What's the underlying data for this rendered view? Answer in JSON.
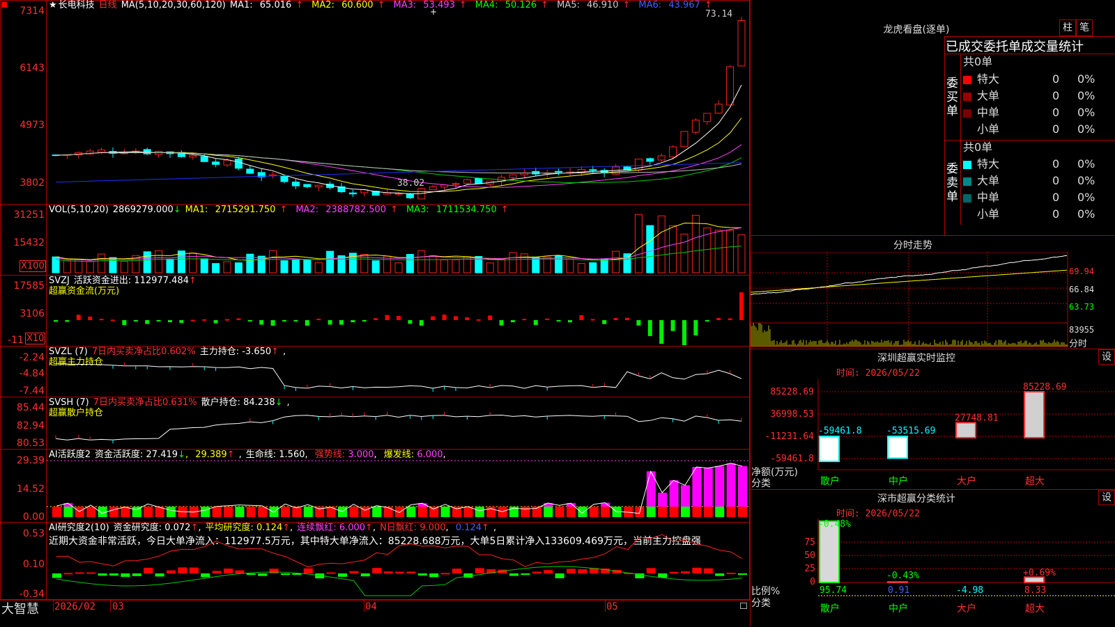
{
  "stock": {
    "name": "长电科技",
    "period": "日线",
    "star": "★"
  },
  "main": {
    "ma_label": "MA(5,10,20,30,60,120)",
    "ma": [
      {
        "label": "MA1:",
        "value": "65.016",
        "arrow": "↑",
        "color": "#ffffff"
      },
      {
        "label": "MA2:",
        "value": "60.600",
        "arrow": "↑",
        "color": "#ffff00"
      },
      {
        "label": "MA3:",
        "value": "53.493",
        "arrow": "↑",
        "color": "#ff40ff"
      },
      {
        "label": "MA4:",
        "value": "50.126",
        "arrow": "↑",
        "color": "#00ff00"
      },
      {
        "label": "MA5:",
        "value": "46.910",
        "arrow": "↑",
        "color": "#cccccc"
      },
      {
        "label": "MA6:",
        "value": "43.967",
        "arrow": "↑",
        "color": "#4060ff"
      }
    ],
    "y_ticks": [
      "7314",
      "6143",
      "4973",
      "3802"
    ],
    "high_label": "73.14",
    "low_label": "38.02"
  },
  "vol": {
    "label": "VOL(5,10,20)",
    "value": "2869279.000",
    "arrow": "↓",
    "ma": [
      {
        "label": "MA1:",
        "value": "2715291.750",
        "arrow": "↑",
        "color": "#ffff00"
      },
      {
        "label": "MA2:",
        "value": "2388782.500",
        "arrow": "↑",
        "color": "#ff40ff"
      },
      {
        "label": "MA3:",
        "value": "1711534.750",
        "arrow": "↑",
        "color": "#00ff00"
      }
    ],
    "y_ticks": [
      "31251",
      "15432"
    ],
    "unit": "X100"
  },
  "svzj": {
    "label": "SVZJ",
    "text": "活跃资金进出:",
    "value": "112977.484",
    "arrow": "↑",
    "sub": "超赢资金流(万元)",
    "y_ticks": [
      "17585",
      "3106",
      "-11"
    ],
    "unit": "X10"
  },
  "svzl": {
    "label": "SVZL (7)",
    "text1": "7日内买卖净占比0.602%",
    "text2": "主力持仓:",
    "value": "-3.650",
    "arrow": "↑",
    "sub": "超赢主力持仓",
    "y_ticks": [
      "-2.24",
      "-4.84",
      "-7.44"
    ]
  },
  "svsh": {
    "label": "SVSH (7)",
    "text1": "7日内买卖净占比0.631%",
    "text2": "散户持仓:",
    "value": "84.238",
    "arrow": "↓",
    "sub": "超赢散户持仓",
    "y_ticks": [
      "85.44",
      "82.94",
      "80.53"
    ]
  },
  "ai_act": {
    "label": "AI活跃度2",
    "text": "资金活跃度:",
    "v1": "27.419",
    "a1": "↓",
    "v2": "29.389",
    "life": "生命线:",
    "life_v": "1.560",
    "strong": "强势线:",
    "strong_v": "3.000",
    "burst": "爆发线:",
    "burst_v": "6.000",
    "y_ticks": [
      "29.39",
      "14.52",
      "0.00"
    ]
  },
  "ai_res": {
    "label": "AI研究度2(10)",
    "text": "资金研究度:",
    "v1": "0.072",
    "a1": "↑",
    "avg": "平均研究度:",
    "avg_v": "0.124",
    "a2": "↑",
    "cont": "连续飘红:",
    "cont_v": "6.000",
    "a3": "↑",
    "n": "N日飘红:",
    "n_v": "9.000",
    "n2": "0.124",
    "comment": "近期大资金非常活跃，今日大单净流入：112977.5万元，其中特大单净流入：85228.688万元，大单5日累计净入133609.469万元，当前主力控盘强",
    "y_ticks": [
      "0.53",
      "0.10",
      "-0.34"
    ]
  },
  "xaxis": {
    "labels": [
      "2026/02",
      "03",
      "04",
      "05"
    ]
  },
  "brand": "大智慧",
  "dragon": {
    "title": "龙虎看盘(逐单)",
    "tab1": "柱",
    "tab2": "笔",
    "tabs_header": "已成交委托单成交量统计",
    "buy": {
      "side": "委买单",
      "total": "共0单",
      "rows": [
        {
          "name": "特大",
          "n": "0",
          "p": "0%",
          "color": "#ff0000"
        },
        {
          "name": "大单",
          "n": "0",
          "p": "0%",
          "color": "#990000"
        },
        {
          "name": "中单",
          "n": "0",
          "p": "0%",
          "color": "#770000"
        },
        {
          "name": "小单",
          "n": "0",
          "p": "0%",
          "color": ""
        }
      ]
    },
    "sell": {
      "side": "委卖单",
      "total": "共0单",
      "rows": [
        {
          "name": "特大",
          "n": "0",
          "p": "0%",
          "color": "#00ffff"
        },
        {
          "name": "大单",
          "n": "0",
          "p": "0%",
          "color": "#008888"
        },
        {
          "name": "中单",
          "n": "0",
          "p": "0%",
          "color": "#006666"
        },
        {
          "name": "小单",
          "n": "0",
          "p": "0%",
          "color": ""
        }
      ]
    }
  },
  "intraday": {
    "title": "分时走势",
    "y_ticks": [
      "69.94",
      "66.84",
      "63.73",
      "83955"
    ],
    "unit": "分时"
  },
  "monitor": {
    "title": "深圳超赢实时监控",
    "set": "设",
    "time": "时间: 2026/05/22",
    "y_ticks": [
      "85228.69",
      "36998.53",
      "-11231.64",
      "-59461.8"
    ],
    "ylabel": "净额(万元)",
    "xlabel": "分类",
    "categories": [
      "散户",
      "中户",
      "大户",
      "超大"
    ],
    "values": [
      "-59461.8",
      "-53515.69",
      "27748.81",
      "85228.69"
    ]
  },
  "classify": {
    "title": "深市超赢分类统计",
    "set": "设",
    "time": "时间: 2026/05/22",
    "y_ticks": [
      "75",
      "50",
      "25",
      "0"
    ],
    "ylabel": "比例%",
    "xlabel": "分类",
    "categories": [
      "散户",
      "中户",
      "大户",
      "超大"
    ],
    "changes": [
      "-0.48%",
      "-0.43%",
      "",
      "+0.69%"
    ],
    "values": [
      "95.74",
      "0.91",
      "-4.98",
      "8.33"
    ]
  },
  "chart_data": [
    {
      "type": "bar",
      "title": "深圳超赢实时监控",
      "xlabel": "分类",
      "ylabel": "净额(万元)",
      "categories": [
        "散户",
        "中户",
        "大户",
        "超大"
      ],
      "values": [
        -59461.8,
        -53515.69,
        27748.81,
        85228.69
      ],
      "ylim": [
        -59461.8,
        85228.69
      ]
    },
    {
      "type": "bar",
      "title": "深市超赢分类统计",
      "xlabel": "分类",
      "ylabel": "比例%",
      "categories": [
        "散户",
        "中户",
        "大户",
        "超大"
      ],
      "values": [
        95.74,
        0.91,
        -4.98,
        8.33
      ],
      "ylim": [
        0,
        100
      ]
    }
  ]
}
